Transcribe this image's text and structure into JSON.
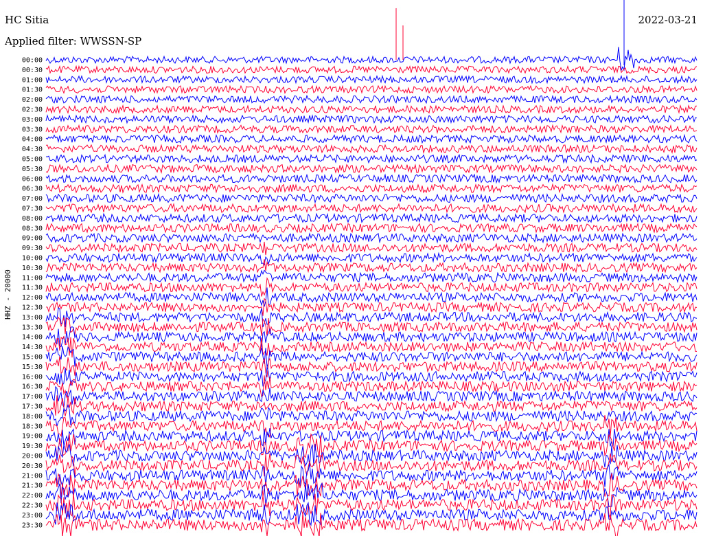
{
  "header": {
    "station": "HC Sitia",
    "filter": "Applied filter: WWSSN-SP",
    "date": "2022-03-21"
  },
  "chart_data": {
    "type": "line",
    "title": "HC Sitia",
    "subtitle": "Applied filter: WWSSN-SP",
    "date": "2022-03-21",
    "ylabel": "HHZ - 20000",
    "row_labels": [
      "00:00",
      "00:30",
      "01:00",
      "01:30",
      "02:00",
      "02:30",
      "03:00",
      "03:30",
      "04:00",
      "04:30",
      "05:00",
      "05:30",
      "06:00",
      "06:30",
      "07:00",
      "07:30",
      "08:00",
      "08:30",
      "09:00",
      "09:30",
      "10:00",
      "10:30",
      "11:00",
      "11:30",
      "12:00",
      "12:30",
      "13:00",
      "13:30",
      "14:00",
      "14:30",
      "15:00",
      "15:30",
      "16:00",
      "16:30",
      "17:00",
      "17:30",
      "18:00",
      "18:30",
      "19:00",
      "19:30",
      "20:00",
      "20:30",
      "21:00",
      "21:30",
      "22:00",
      "22:30",
      "23:00",
      "23:30"
    ],
    "series_colors": [
      "#0000ff",
      "#ff0033"
    ],
    "grid": false
  }
}
